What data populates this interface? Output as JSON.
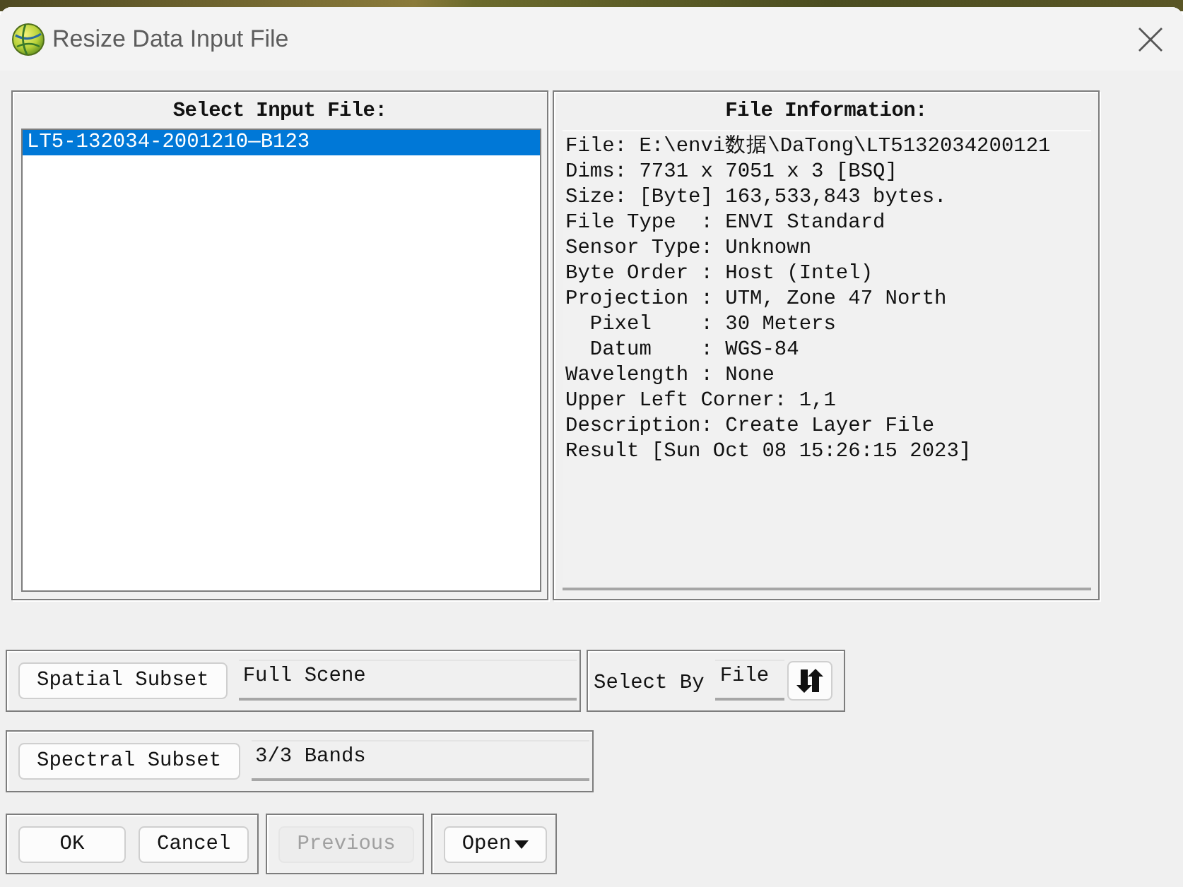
{
  "window": {
    "title": "Resize Data Input File"
  },
  "input_files": {
    "heading": "Select Input File:",
    "items": [
      {
        "label": "LT5-132034-2001210—B123",
        "selected": true
      }
    ]
  },
  "file_info": {
    "heading": "File Information:",
    "lines": [
      "File: E:\\envi数据\\DaTong\\LT5132034200121",
      "Dims: 7731 x 7051 x 3 [BSQ]",
      "Size: [Byte] 163,533,843 bytes.",
      "File Type  : ENVI Standard",
      "Sensor Type: Unknown",
      "Byte Order : Host (Intel)",
      "Projection : UTM, Zone 47 North",
      "  Pixel    : 30 Meters",
      "  Datum    : WGS-84",
      "Wavelength : None",
      "Upper Left Corner: 1,1",
      "Description: Create Layer File",
      "Result [Sun Oct 08 15:26:15 2023]"
    ]
  },
  "spatial_subset": {
    "button": "Spatial Subset",
    "value": "Full Scene"
  },
  "select_by": {
    "label": "Select By",
    "value": "File"
  },
  "spectral_subset": {
    "button": "Spectral Subset",
    "value": "3/3 Bands"
  },
  "button_groups": [
    {
      "buttons": [
        {
          "label": "OK",
          "kind": "push",
          "disabled": false
        },
        {
          "label": "Cancel",
          "kind": "push",
          "disabled": false
        }
      ]
    },
    {
      "buttons": [
        {
          "label": "Previous",
          "kind": "push",
          "disabled": true
        }
      ]
    },
    {
      "buttons": [
        {
          "label": "Open",
          "kind": "menu",
          "disabled": false
        }
      ]
    }
  ]
}
